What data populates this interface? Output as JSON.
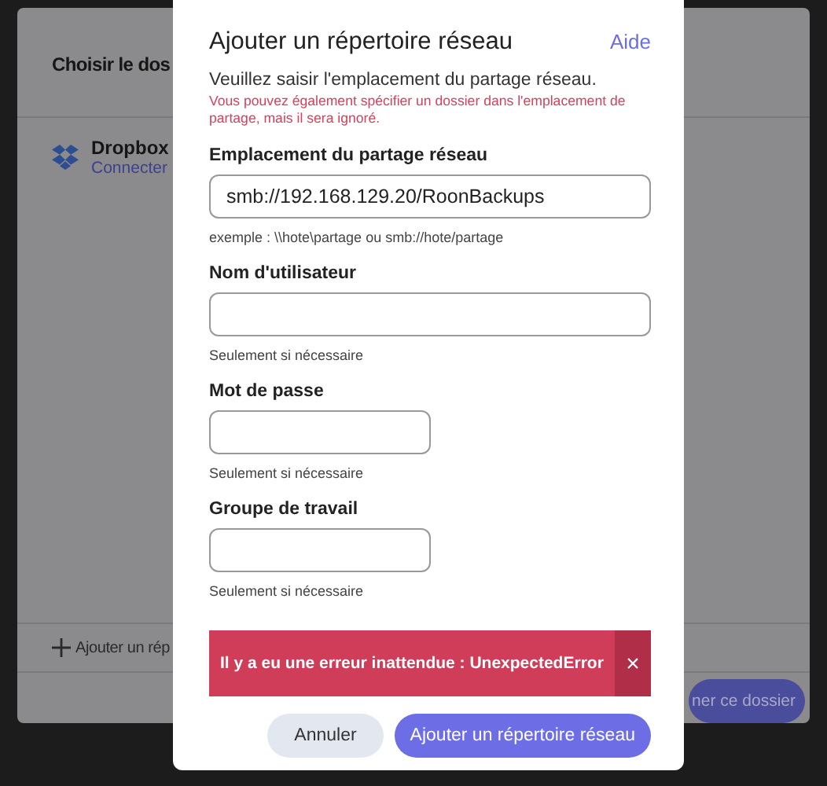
{
  "background": {
    "title": "Choisir le dos",
    "sources": [
      {
        "name": "Dropbox",
        "action": "Connecter"
      }
    ],
    "add_link": "Ajouter un rép",
    "confirm_button": "ner ce dossier"
  },
  "dialog": {
    "title": "Ajouter un répertoire réseau",
    "help_link": "Aide",
    "intro": "Veuillez saisir l'emplacement du partage réseau.",
    "warning": "Vous pouvez également spécifier un dossier dans l'emplacement de partage, mais il sera ignoré.",
    "fields": [
      {
        "label": "Emplacement du partage réseau",
        "value": "smb://192.168.129.20/RoonBackups",
        "hint": "exemple : \\\\hote\\partage ou smb://hote/partage",
        "kind": "wide"
      },
      {
        "label": "Nom d'utilisateur",
        "hint": "Seulement si nécessaire",
        "kind": "wide"
      },
      {
        "label": "Mot de passe",
        "hint": "Seulement si nécessaire",
        "kind": "narrow"
      },
      {
        "label": "Groupe de travail",
        "hint": "Seulement si nécessaire",
        "kind": "narrow"
      }
    ],
    "error": {
      "message": "Il y a eu une erreur inattendue : UnexpectedError",
      "close": "×"
    },
    "buttons": [
      {
        "label": "Annuler",
        "kind": "secondary"
      },
      {
        "label": "Ajouter un répertoire réseau",
        "kind": "primary"
      }
    ]
  }
}
